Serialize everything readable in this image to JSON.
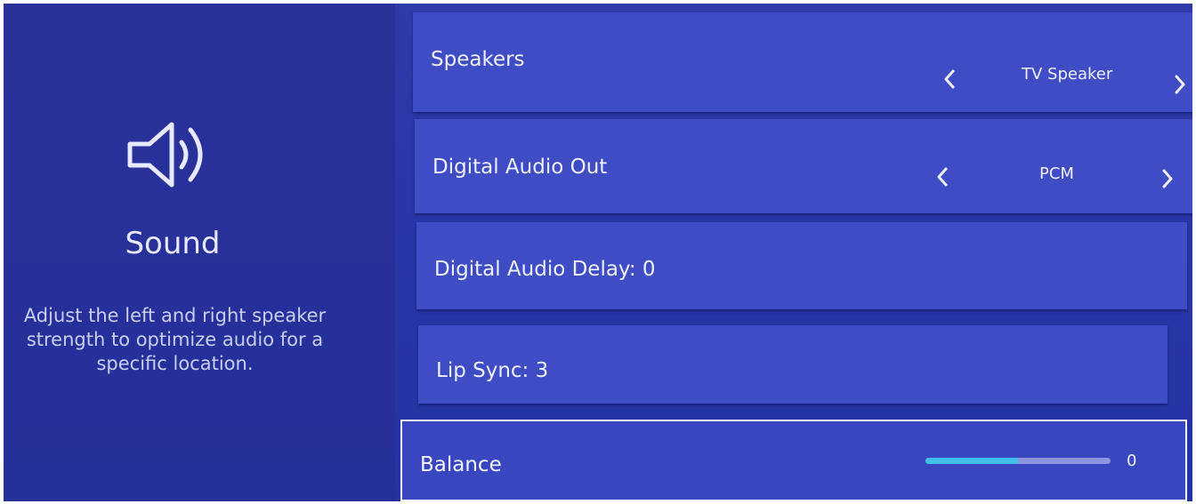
{
  "left_panel": {
    "icon": "speaker-volume-icon",
    "title": "Sound",
    "description": "Adjust the left and right speaker strength to optimize audio for a specific location."
  },
  "settings": [
    {
      "label": "Speakers",
      "value": "TV Speaker"
    },
    {
      "label": "Digital Audio Out",
      "value": "PCM"
    },
    {
      "label": "Digital Audio Delay: 0"
    },
    {
      "label": "Lip Sync: 3"
    },
    {
      "label": "Balance",
      "value": "0",
      "level": 0.5
    }
  ],
  "colors": {
    "screen_bg": "#2a36a6",
    "row_bg": "#3f4cc3",
    "text": "#eef0ff",
    "slider_fill": "#3fc0e8"
  }
}
